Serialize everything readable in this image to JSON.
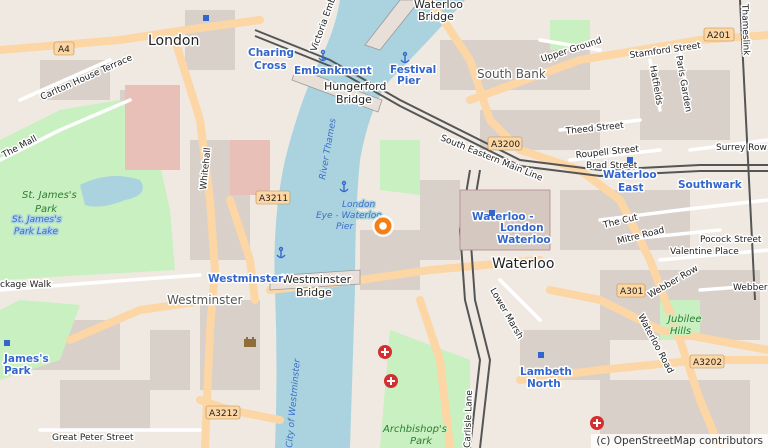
{
  "places": {
    "london": "London",
    "south_bank": "South Bank",
    "waterloo": "Waterloo",
    "westminster": "Westminster"
  },
  "bridges": {
    "waterloo": "Waterloo\nBridge",
    "hungerford": "Hungerford\nBridge",
    "westminster": "Westminster\nBridge"
  },
  "stations": {
    "charing_cross": "Charing\nCross",
    "embankment": "Embankment",
    "festival_pier": "Festival\nPier",
    "waterloo_east": "Waterloo\nEast",
    "southwark": "Southwark",
    "waterloo_london": "Waterloo -\nLondon\nWaterloo",
    "westminster": "Westminster",
    "lambeth_north": "Lambeth\nNorth",
    "james_park": "James's\nPark"
  },
  "water": {
    "river_thames": "River Thames",
    "london_eye_pier": "London\nEye - Waterloo\nPier",
    "city_of_westminster": "City of Westminster",
    "victoria_emb": "Victoria Emb"
  },
  "parks": {
    "st_james_park": "St. James's\nPark",
    "st_james_park_lake": "St. James's\nPark Lake",
    "archbishops_park": "Archbishop's\nPark",
    "jubilee_hills": "Jubilee\nHills"
  },
  "roads": {
    "the_mall": "The Mall",
    "carlton_house_terrace": "Carlton House Terrace",
    "whitehall": "Whitehall",
    "upper_ground": "Upper Ground",
    "stamford_street": "Stamford Street",
    "hatfields": "Hatfields",
    "paris_garden": "Paris Garden",
    "theed_street": "Theed Street",
    "roupell_street": "Roupell Street",
    "brad_street": "Brad Street",
    "south_eastern_main_line": "South Eastern Main Line",
    "the_cut": "The Cut",
    "mitre_road": "Mitre Road",
    "valentine_place": "Valentine Place",
    "pocock_street": "Pocock Street",
    "surrey_row": "Surrey Row",
    "webber_row": "Webber Row",
    "webber_street": "Webber Street",
    "waterloo_road": "Waterloo Road",
    "lower_marsh": "Lower Marsh",
    "carlisle_lane": "Carlisle Lane",
    "great_peter_street": "Great Peter Street",
    "ge_walk": "ckage Walk",
    "thameslink": "Thameslink"
  },
  "shields": {
    "a4": "A4",
    "a201": "A201",
    "a3200": "A3200",
    "a3211": "A3211",
    "a301": "A301",
    "a3202": "A3202",
    "a3212": "A3212"
  },
  "attribution": "(c) OpenStreetMap contributors",
  "marker": {
    "color": "#f57f17"
  },
  "colors": {
    "river": "#aad3df",
    "park": "#c8f0c0",
    "primary_road": "#fcd6a4",
    "building": "#d9d0c9",
    "railway": "#555555",
    "station_text": "#3366cc",
    "hospital": "#d32f2f"
  }
}
